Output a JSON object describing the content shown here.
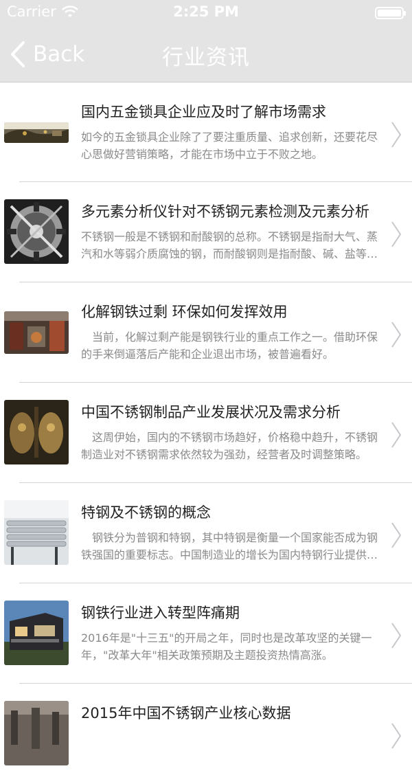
{
  "status_bar": {
    "carrier": "Carrier",
    "time": "2:25 PM",
    "wifi_icon": "wifi-icon",
    "battery_icon": "battery-icon"
  },
  "nav": {
    "back_label": "Back",
    "back_icon": "chevron-left-icon",
    "title": "行业资讯",
    "bar_color": "#e4e4e4"
  },
  "news": [
    {
      "title": "国内五金锁具企业应及时了解市场需求",
      "desc": "如今的五金锁具企业除了了要注重质量、追求创新，还要花尽心思做好营销策略，才能在市场中立于不败之地。"
    },
    {
      "title": "多元素分析仪针对不锈钢元素检测及元素分析",
      "desc": "不锈钢一般是不锈钢和耐酸钢的总称。不锈钢是指耐大气、蒸汽和水等弱介质腐蚀的钢，而耐酸钢则是指耐酸、碱、盐等化学浸蚀性介质腐蚀的钢。"
    },
    {
      "title": "化解钢铁过剩 环保如何发挥效用",
      "desc": "　当前，化解过剩产能是钢铁行业的重点工作之一。借助环保的手来倒逼落后产能和企业退出市场，被普遍看好。"
    },
    {
      "title": "中国不锈钢制品产业发展状况及需求分析",
      "desc": "　这周伊始，国内的不锈钢市场趋好，价格稳中趋升，不锈钢制造业对不锈钢需求依然较为强劲，经营者及时调整策略。"
    },
    {
      "title": "特钢及不锈钢的概念",
      "desc": "　钢铁分为普钢和特钢，其中特钢是衡量一个国家能否成为钢铁强国的重要标志。中国制造业的增长为国内特钢行业提供了广阔的市场。"
    },
    {
      "title": "钢铁行业进入转型阵痛期",
      "desc": "2016年是\"十三五\"的开局之年，同时也是改革攻坚的关键一年，\"改革大年\"相关政策预期及主题投资热情高涨。"
    },
    {
      "title": "2015年中国不锈钢产业核心数据",
      "desc": ""
    }
  ]
}
